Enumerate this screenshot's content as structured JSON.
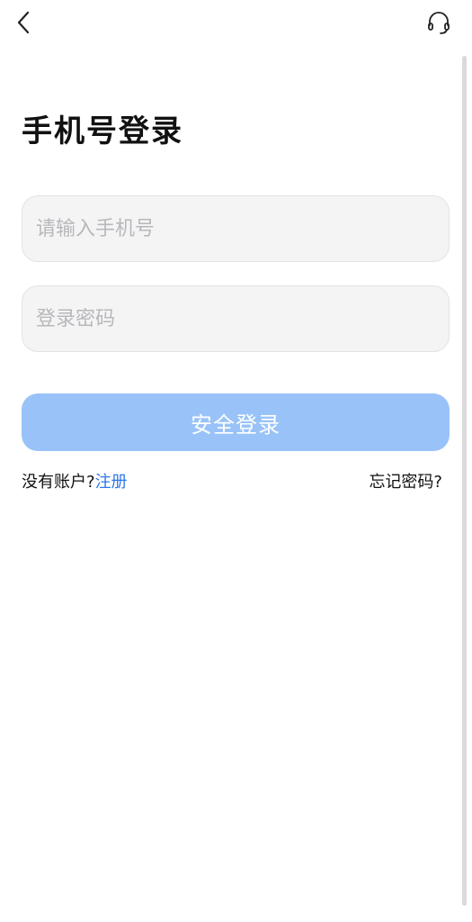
{
  "header": {
    "back_icon": "chevron-left-icon",
    "support_icon": "headset-icon"
  },
  "page": {
    "title": "手机号登录"
  },
  "form": {
    "phone_placeholder": "请输入手机号",
    "phone_value": "",
    "password_placeholder": "登录密码",
    "password_value": "",
    "submit_label": "安全登录"
  },
  "links": {
    "no_account_text": "没有账户?",
    "register_label": "注册",
    "forgot_label": "忘记密码?"
  },
  "colors": {
    "accent": "#2f78e8",
    "button_disabled": "#99c3f8",
    "input_background": "#f4f4f5",
    "placeholder": "#b8b8bc"
  }
}
